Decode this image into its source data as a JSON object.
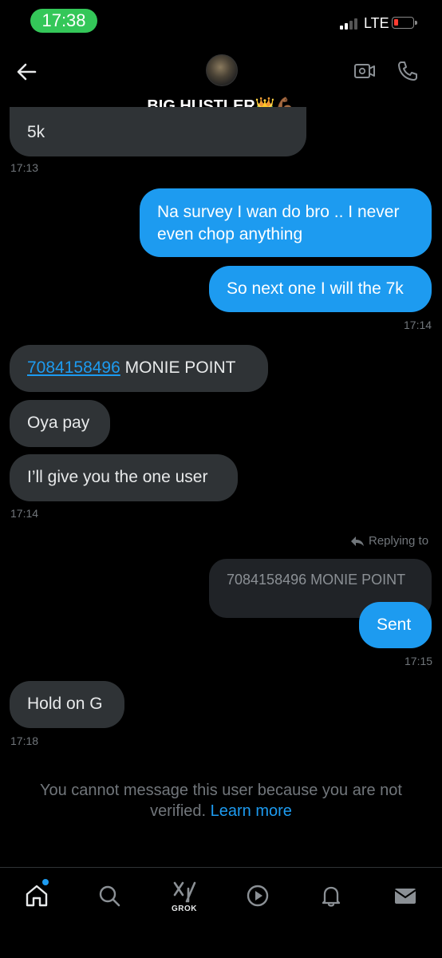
{
  "status_bar": {
    "time": "17:38",
    "network": "LTE",
    "colors": {
      "time_pill": "#34c759",
      "battery": "#ff3b30"
    }
  },
  "header": {
    "contact_name": "BIG HUSTLER👑💪🏾",
    "icons": [
      "back-arrow-icon",
      "video-call-icon",
      "phone-icon"
    ]
  },
  "messages": [
    {
      "side": "in",
      "text": "5k",
      "time": "17:13"
    },
    {
      "side": "out",
      "text": "Na survey I wan do bro .. I never even chop anything"
    },
    {
      "side": "out",
      "text": "So next one I will the 7k",
      "time": "17:14"
    },
    {
      "side": "in",
      "link": "7084158496",
      "text": "MONIE POINT"
    },
    {
      "side": "in",
      "text": "Oya pay"
    },
    {
      "side": "in",
      "text": "I’ll give you the one user",
      "time": "17:14"
    },
    {
      "side": "out",
      "replying_label": "Replying to",
      "quoted": "7084158496 MONIE POINT",
      "text": "Sent",
      "time": "17:15"
    },
    {
      "side": "in",
      "text": "Hold on G",
      "time": "17:18"
    }
  ],
  "notice": {
    "text": "You cannot message this user because you are not verified.",
    "link": "Learn more"
  },
  "bottom_nav": [
    {
      "name": "home",
      "icon": "home-icon",
      "active": true
    },
    {
      "name": "search",
      "icon": "search-icon"
    },
    {
      "name": "grok",
      "icon": "grok-icon",
      "label": "GROK"
    },
    {
      "name": "video",
      "icon": "play-icon"
    },
    {
      "name": "notifications",
      "icon": "bell-icon"
    },
    {
      "name": "messages",
      "icon": "mail-icon"
    }
  ],
  "theme": {
    "accent": "#1d9bf0",
    "incoming_bubble": "#2f3336",
    "background": "#000000",
    "muted_text": "#71767b"
  }
}
